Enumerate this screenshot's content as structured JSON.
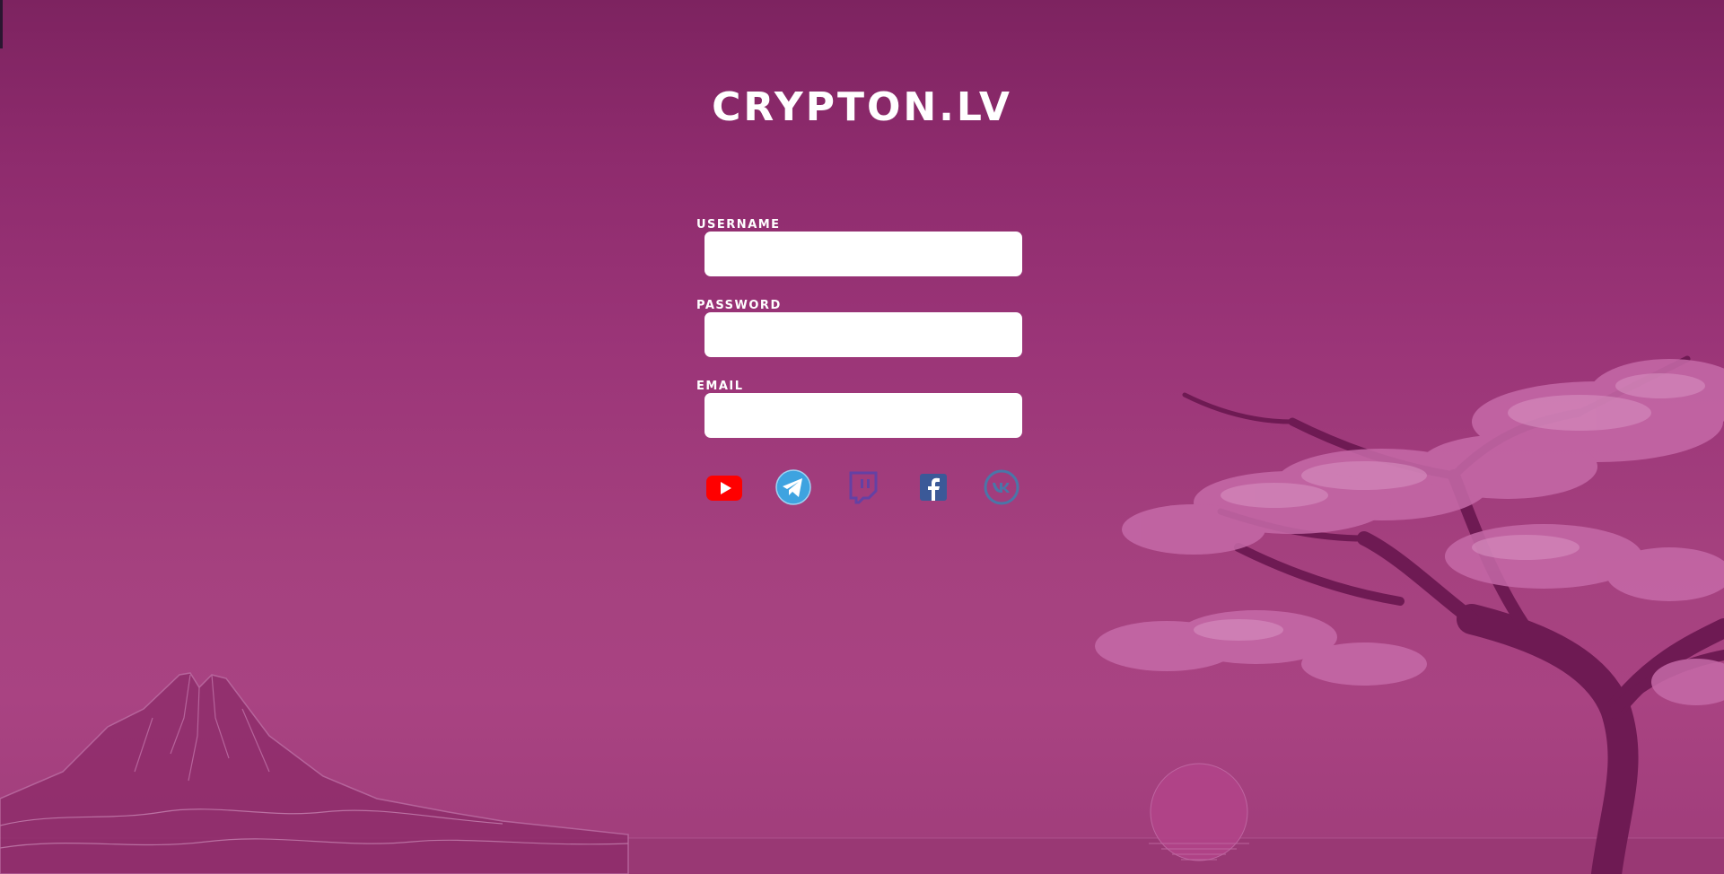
{
  "app": {
    "logo_text": "CRYPTON.LV"
  },
  "form": {
    "fields": [
      {
        "label": "USERNAME",
        "value": "",
        "placeholder": ""
      },
      {
        "label": "PASSWORD",
        "value": "",
        "placeholder": ""
      },
      {
        "label": "EMAIL",
        "value": "",
        "placeholder": ""
      }
    ]
  },
  "social": [
    {
      "icon": "youtube-icon",
      "color": "#ff0000"
    },
    {
      "icon": "telegram-icon",
      "color": "#3ea3e0"
    },
    {
      "icon": "twitch-icon",
      "color": "#6441a4"
    },
    {
      "icon": "facebook-icon",
      "color": "#3b5998"
    },
    {
      "icon": "vk-icon",
      "color": "#4a76a8"
    }
  ],
  "theme": {
    "background_top": "#7d2360",
    "background_bottom": "#a94382",
    "tree_blossom": "#c66aa8",
    "tree_trunk": "#6e1a53"
  }
}
